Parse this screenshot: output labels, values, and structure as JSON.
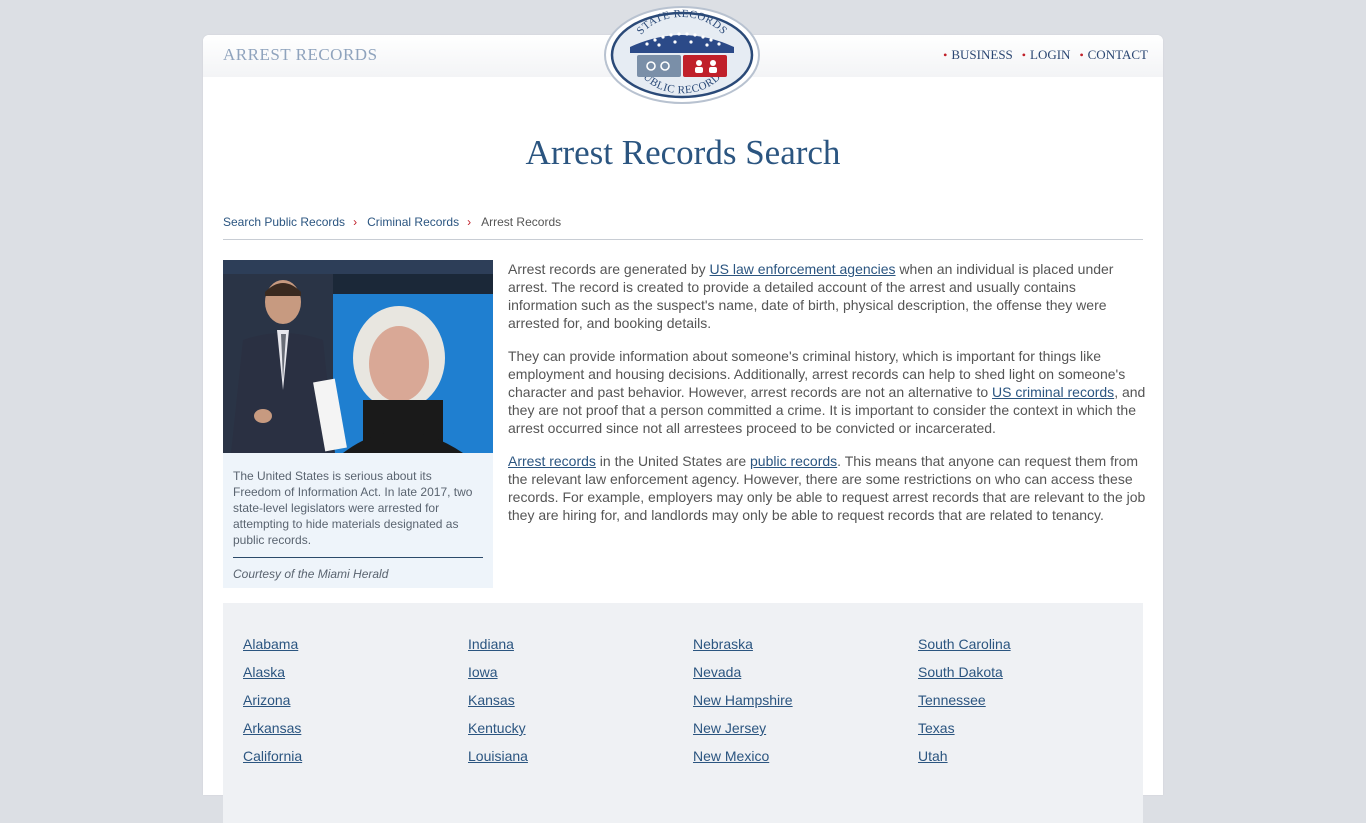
{
  "header": {
    "brand": "ARREST RECORDS",
    "nav": [
      "BUSINESS",
      "LOGIN",
      "CONTACT"
    ],
    "seal_top": "STATE RECORDS",
    "seal_bottom": "PUBLIC RECORDS"
  },
  "page_title": "Arrest Records Search",
  "breadcrumb": [
    "Search Public Records",
    "Criminal Records",
    "Arrest Records"
  ],
  "figure": {
    "caption": "The United States is serious about its Freedom of Information Act. In late 2017, two state-level legislators were arrested for attempting to hide materials designated as public records.",
    "courtesy": "Courtesy of the Miami Herald"
  },
  "paragraphs": {
    "p1_a": "Arrest records are generated by ",
    "p1_link": "US law enforcement agencies",
    "p1_b": " when an individual is placed under arrest. The record is created to provide a detailed account of the arrest and usually contains information such as the suspect's name, date of birth, physical description, the offense they were arrested for, and booking details.",
    "p2_a": "They can provide information about someone's criminal history, which is important for things like employment and housing decisions. Additionally, arrest records can help to shed light on someone's character and past behavior. However, arrest records are not an alternative to ",
    "p2_link": "US criminal records",
    "p2_b": ", and they are not proof that a person committed a crime. It is important to consider the context in which the arrest occurred since not all arrestees proceed to be convicted or incarcerated.",
    "p3_link1": "Arrest records",
    "p3_a": " in the United States are ",
    "p3_link2": "public records",
    "p3_b": ". This means that anyone can request them from the relevant law enforcement agency. However, there are some restrictions on who can access these records. For example, employers may only be able to request arrest records that are relevant to the job they are hiring for, and landlords may only be able to request records that are related to tenancy."
  },
  "states": [
    "Alabama",
    "Indiana",
    "Nebraska",
    "South Carolina",
    "Alaska",
    "Iowa",
    "Nevada",
    "South Dakota",
    "Arizona",
    "Kansas",
    "New Hampshire",
    "Tennessee",
    "Arkansas",
    "Kentucky",
    "New Jersey",
    "Texas",
    "California",
    "Louisiana",
    "New Mexico",
    "Utah"
  ],
  "colors": {
    "accent": "#2b5580",
    "red": "#c0202a",
    "page_bg": "#dcdfe4"
  }
}
